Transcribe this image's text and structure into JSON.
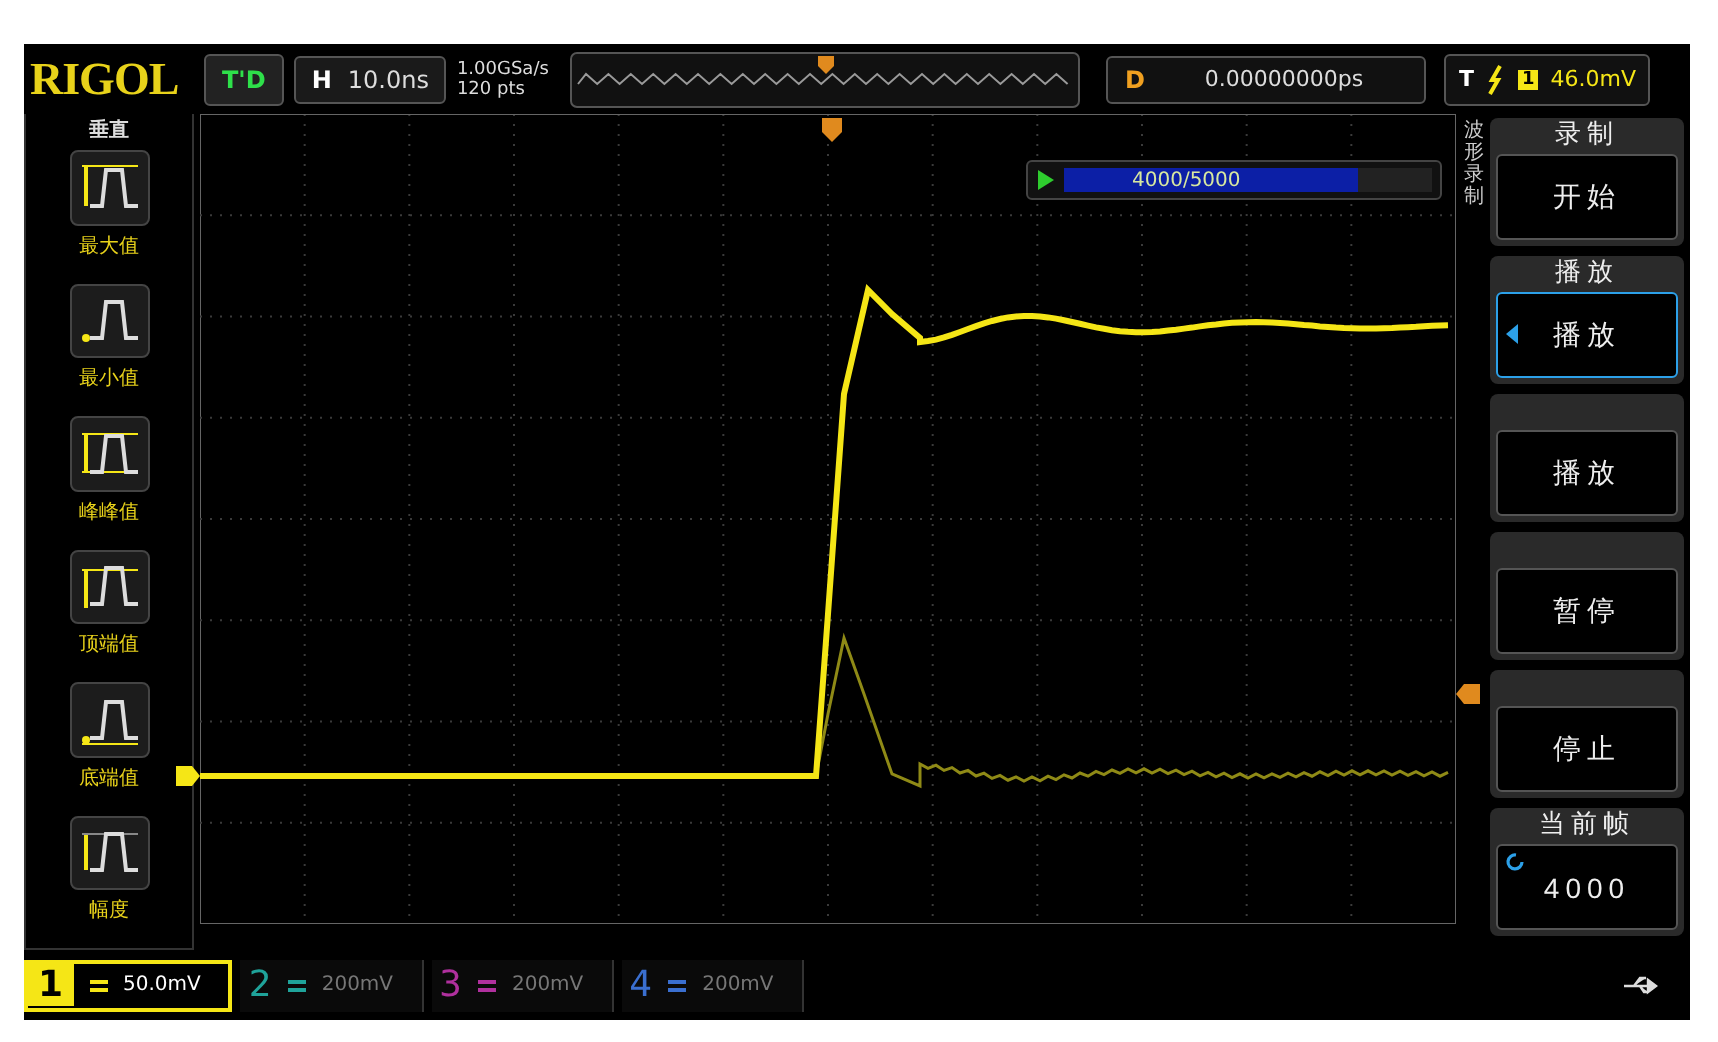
{
  "logo": "RIGOL",
  "run_status": "T'D",
  "timebase": {
    "label": "H",
    "value": "10.0ns"
  },
  "sample_rate": "1.00GSa/s",
  "memory_depth": "120 pts",
  "delay": {
    "label": "D",
    "value": "0.00000000ps"
  },
  "trigger": {
    "label": "T",
    "source": "1",
    "level": "46.0mV"
  },
  "measure_menu": {
    "title": "垂直",
    "items": [
      {
        "label": "最大值",
        "kind": "max"
      },
      {
        "label": "最小值",
        "kind": "min"
      },
      {
        "label": "峰峰值",
        "kind": "pkpk"
      },
      {
        "label": "顶端值",
        "kind": "top"
      },
      {
        "label": "底端值",
        "kind": "base"
      },
      {
        "label": "幅度",
        "kind": "amp"
      }
    ]
  },
  "record_panel": {
    "title": "波形录制",
    "progress": {
      "text": "4000/5000",
      "level": 0.8
    }
  },
  "softkeys": [
    {
      "title": "录制",
      "value": "开始",
      "kind": "button",
      "selected": false
    },
    {
      "title": "播放",
      "value": "播放",
      "kind": "button",
      "selected": true
    },
    {
      "value": "播放",
      "kind": "button",
      "selected": false
    },
    {
      "value": "暂停",
      "kind": "button",
      "selected": false
    },
    {
      "value": "停止",
      "kind": "button",
      "selected": false
    },
    {
      "title": "当前帧",
      "value": "4000",
      "kind": "knob",
      "selected": false
    }
  ],
  "channels": [
    {
      "number": "1",
      "scale": "50.0mV",
      "color": "#f5e616",
      "selected": true
    },
    {
      "number": "2",
      "scale": "200mV",
      "color": "#1fa39a",
      "selected": false
    },
    {
      "number": "3",
      "scale": "200mV",
      "color": "#b0309e",
      "selected": false
    },
    {
      "number": "4",
      "scale": "200mV",
      "color": "#3a6fd0",
      "selected": false
    }
  ]
}
